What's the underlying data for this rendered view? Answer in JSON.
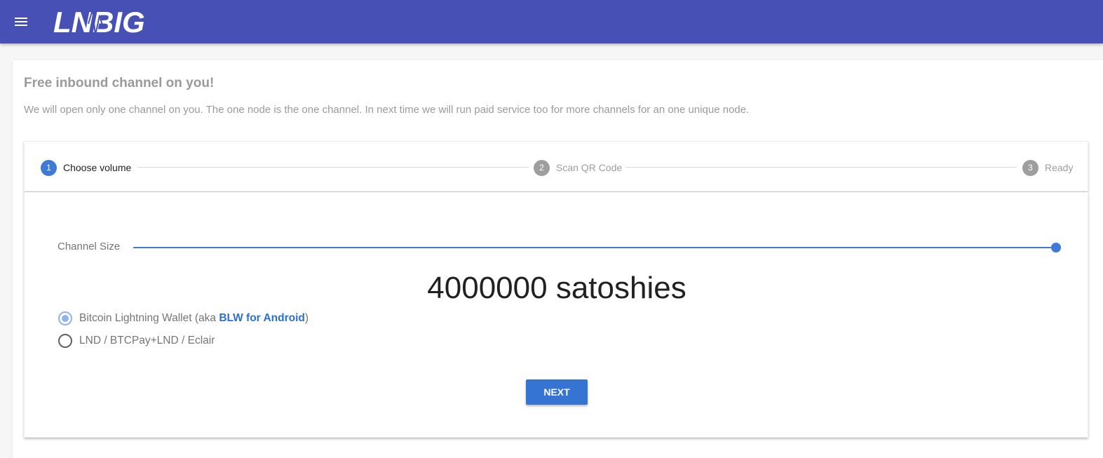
{
  "appbar": {
    "logo_text": "LNBIG",
    "menu_icon": "hamburger-menu-icon",
    "color": "#4650b5"
  },
  "page": {
    "title": "Free inbound channel on you!",
    "description": "We will open only one channel on you. The one node is the one channel. In next time we will run paid service too for more channels for an one unique node."
  },
  "stepper": {
    "steps": [
      {
        "number": "1",
        "label": "Choose volume",
        "active": true
      },
      {
        "number": "2",
        "label": "Scan QR Code",
        "active": false
      },
      {
        "number": "3",
        "label": "Ready",
        "active": false
      }
    ],
    "active_color": "#3f7ad6",
    "inactive_color": "#9e9e9e"
  },
  "channel": {
    "slider_label": "Channel Size",
    "slider_level": 1.0,
    "amount": "4000000 satoshies"
  },
  "wallets": {
    "options": [
      {
        "label_prefix": "Bitcoin Lightning Wallet (aka ",
        "link_text": "BLW for Android",
        "label_suffix": ")",
        "checked": true
      },
      {
        "label": "LND / BTCPay+LND / Eclair",
        "checked": false
      }
    ]
  },
  "actions": {
    "next_label": "NEXT",
    "accent": "#3674d3"
  }
}
